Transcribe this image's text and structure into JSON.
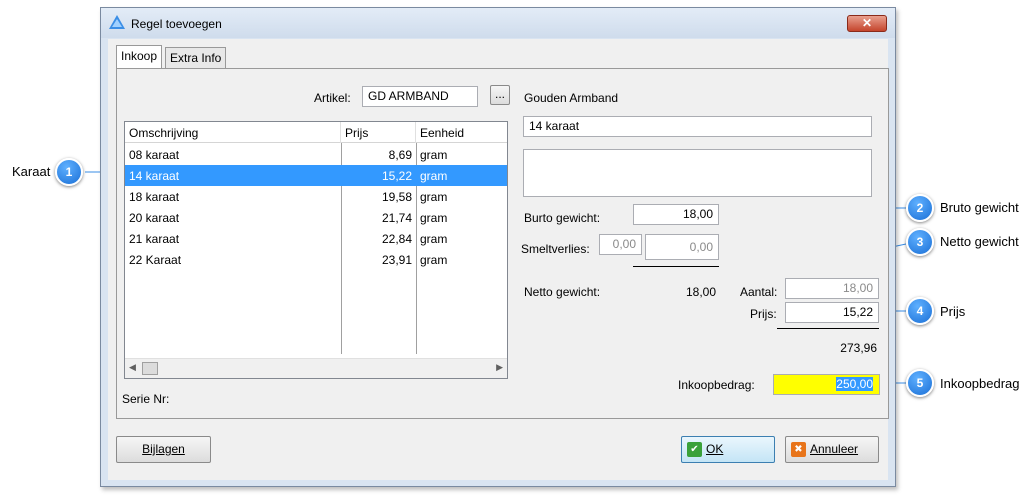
{
  "window": {
    "title": "Regel toevoegen",
    "close_label": "✕"
  },
  "tabs": [
    {
      "label": "Inkoop"
    },
    {
      "label": "Extra Info"
    }
  ],
  "artikel": {
    "label": "Artikel:",
    "value": "GD ARMBAND",
    "browse_label": "...",
    "description": "Gouden Armband"
  },
  "grid": {
    "columns": [
      "Omschrijving",
      "Prijs",
      "Eenheid"
    ],
    "rows": [
      {
        "omschrijving": "08 karaat",
        "prijs": "8,69",
        "eenheid": "gram"
      },
      {
        "omschrijving": "14 karaat",
        "prijs": "15,22",
        "eenheid": "gram"
      },
      {
        "omschrijving": "18 karaat",
        "prijs": "19,58",
        "eenheid": "gram"
      },
      {
        "omschrijving": "20 karaat",
        "prijs": "21,74",
        "eenheid": "gram"
      },
      {
        "omschrijving": "21 karaat",
        "prijs": "22,84",
        "eenheid": "gram"
      },
      {
        "omschrijving": "22 Karaat",
        "prijs": "23,91",
        "eenheid": "gram"
      }
    ],
    "selected_index": 1
  },
  "serie_nr_label": "Serie Nr:",
  "detail": {
    "line1": "14 karaat",
    "line2": "",
    "bruto_label": "Burto gewicht:",
    "bruto_value": "18,00",
    "smeltverlies_label": "Smeltverlies:",
    "smeltverlies_pct": "0,00",
    "smeltverlies_value": "0,00",
    "netto_label": "Netto gewicht:",
    "netto_value": "18,00",
    "aantal_label": "Aantal:",
    "aantal_value": "18,00",
    "prijs_label": "Prijs:",
    "prijs_value": "15,22",
    "subtotal": "273,96",
    "inkoopbedrag_label": "Inkoopbedrag:",
    "inkoopbedrag_value": "250,00"
  },
  "buttons": {
    "bijlagen": "Bijlagen",
    "ok": "OK",
    "annuleer": "Annuleer"
  },
  "callouts": [
    {
      "number": "1",
      "text": "Karaat"
    },
    {
      "number": "2",
      "text": "Bruto gewicht"
    },
    {
      "number": "3",
      "text": "Netto gewicht"
    },
    {
      "number": "4",
      "text": "Prijs"
    },
    {
      "number": "5",
      "text": "Inkoopbedrag"
    }
  ],
  "colors": {
    "selection": "#3399ff",
    "callout": "#1a6fd6",
    "highlight_field": "#ffff00"
  }
}
